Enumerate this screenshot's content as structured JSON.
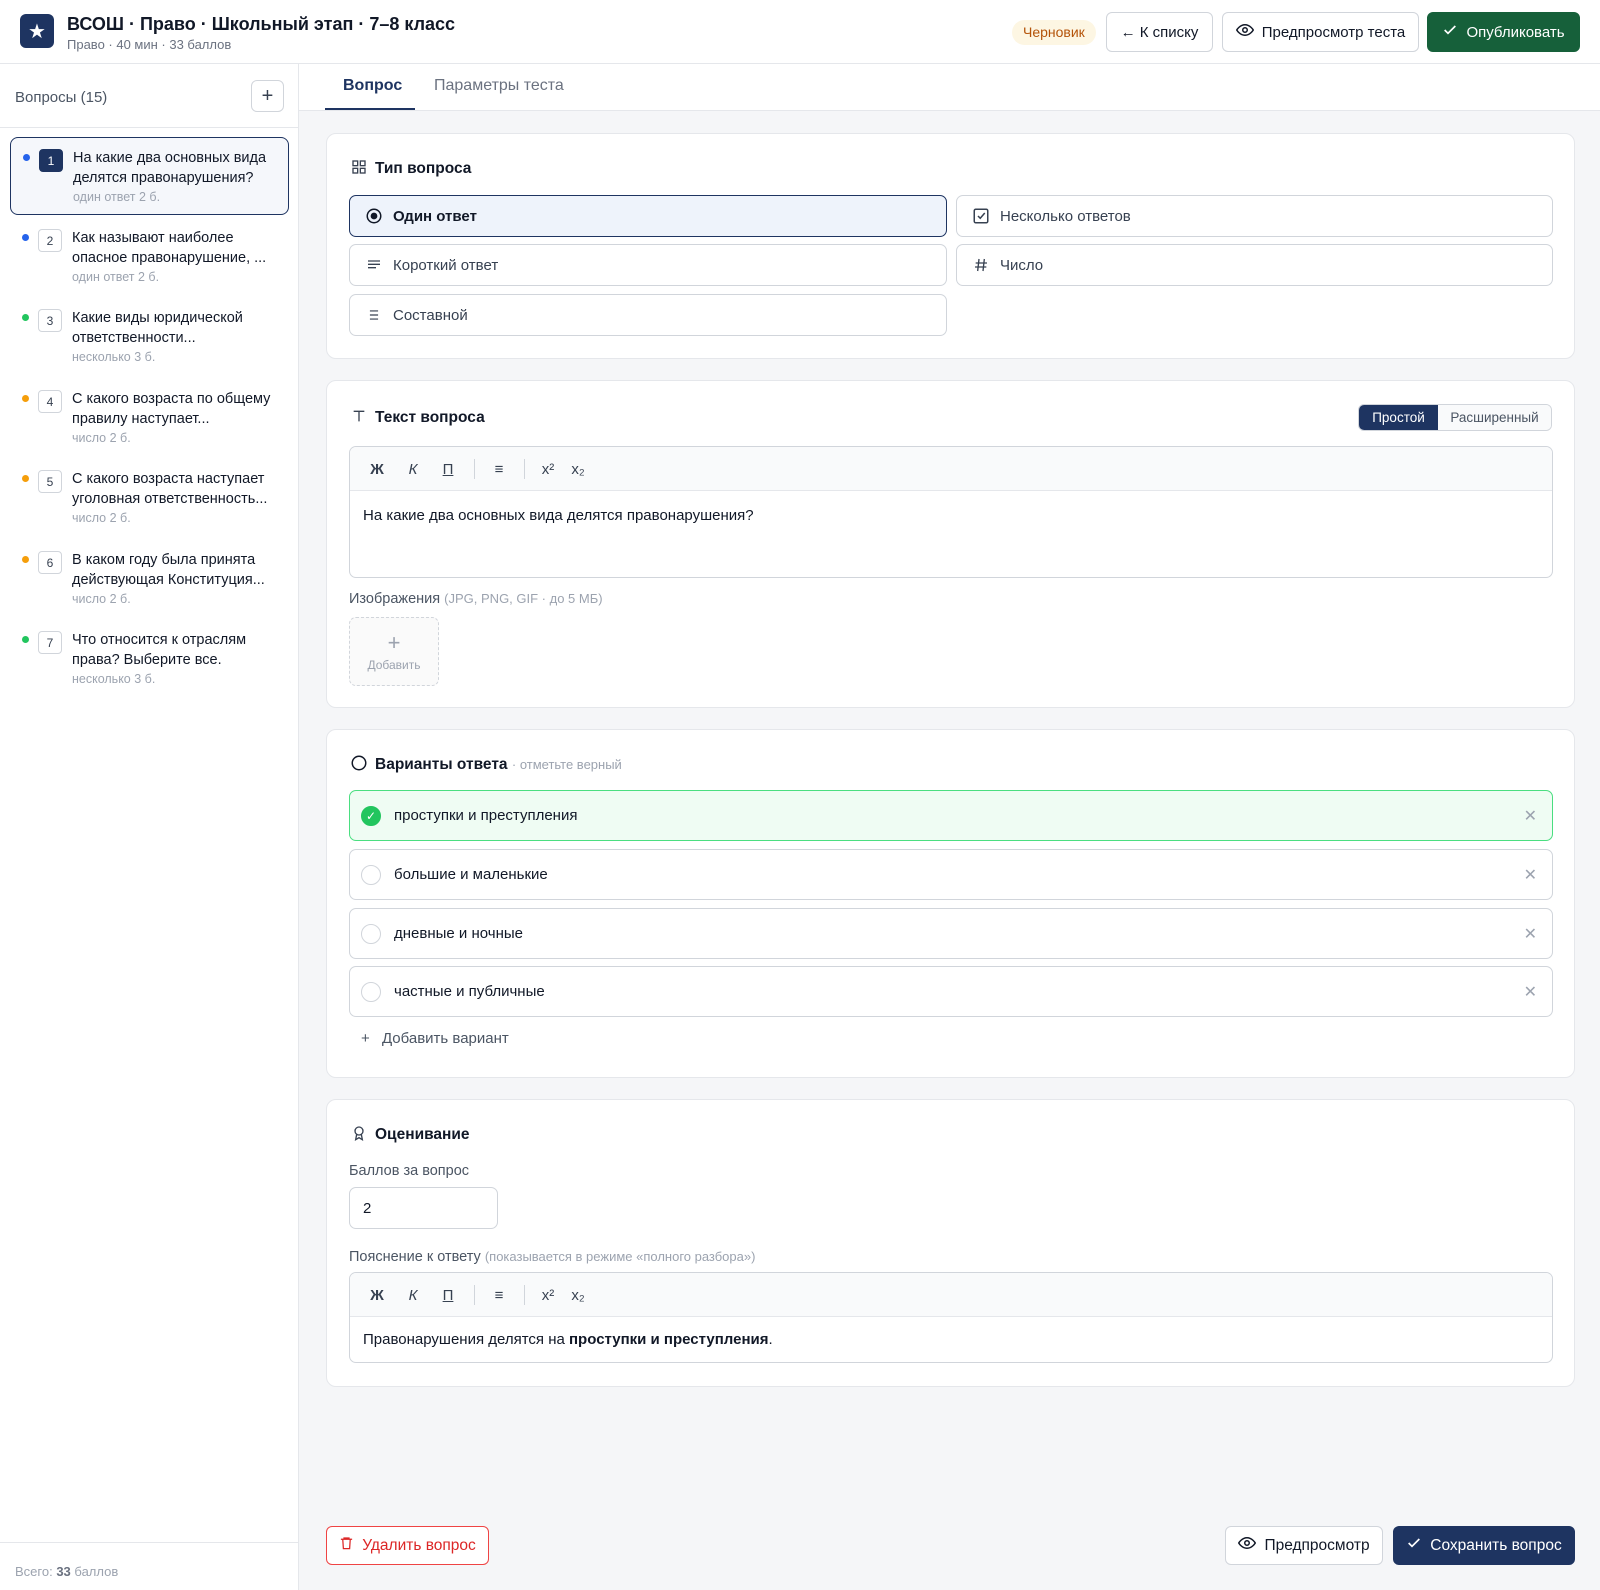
{
  "header": {
    "logo_glyph": "★",
    "title": "ВСОШ · Право · Школьный этап · 7–8 класс",
    "subtitle": "Право · 40 мин · 33 баллов",
    "status_badge": "Черновик",
    "back_label": "← К списку",
    "preview_test_label": "Предпросмотр теста",
    "publish_label": "Опубликовать"
  },
  "sidebar": {
    "heading": "Вопросы (15)",
    "add_label": "+",
    "items": [
      {
        "num": "1",
        "text": "На какие два основных вида делятся правонарушения?",
        "type": "один ответ",
        "points": "2 б.",
        "dot": "#2563eb",
        "active": true
      },
      {
        "num": "2",
        "text": "Как называют наиболее опасное правонарушение, ...",
        "type": "один ответ",
        "points": "2 б.",
        "dot": "#2563eb"
      },
      {
        "num": "3",
        "text": "Какие виды юридической ответственности...",
        "type": "несколько",
        "points": "3 б.",
        "dot": "#22c55e"
      },
      {
        "num": "4",
        "text": "С какого возраста по общему правилу наступает...",
        "type": "число",
        "points": "2 б.",
        "dot": "#f59e0b"
      },
      {
        "num": "5",
        "text": "С какого возраста наступает уголовная ответственность...",
        "type": "число",
        "points": "2 б.",
        "dot": "#f59e0b"
      },
      {
        "num": "6",
        "text": "В каком году была принята действующая Конституция...",
        "type": "число",
        "points": "2 б.",
        "dot": "#f59e0b"
      },
      {
        "num": "7",
        "text": "Что относится к отраслям права? Выберите все.",
        "type": "несколько",
        "points": "3 б.",
        "dot": "#22c55e"
      }
    ],
    "footer_prefix": "Всего:",
    "footer_total": "33",
    "footer_suffix": "баллов"
  },
  "tabs": {
    "question": "Вопрос",
    "params": "Параметры теста"
  },
  "question_type": {
    "title": "Тип вопроса",
    "options": {
      "single": "Один ответ",
      "multiple": "Несколько ответов",
      "short": "Короткий ответ",
      "number": "Число",
      "composite": "Составной"
    },
    "selected": "single"
  },
  "question_text": {
    "title": "Текст вопроса",
    "mode_simple": "Простой",
    "mode_advanced": "Расширенный",
    "toolbar": {
      "bold": "Ж",
      "italic": "К",
      "underline": "П",
      "list": "≡",
      "sup": "x²",
      "sub": "x₂"
    },
    "content": "На какие два основных вида делятся правонарушения?",
    "images_label": "Изображения",
    "images_hint": "(JPG, PNG, GIF · до 5 МБ)",
    "add_image_label": "Добавить"
  },
  "answers": {
    "title": "Варианты ответа",
    "hint": "· отметьте верный",
    "options": [
      {
        "text": "проступки и преступления",
        "correct": true
      },
      {
        "text": "большие и маленькие",
        "correct": false
      },
      {
        "text": "дневные и ночные",
        "correct": false
      },
      {
        "text": "частные и публичные",
        "correct": false
      }
    ],
    "add_label": "Добавить вариант"
  },
  "grading": {
    "title": "Оценивание",
    "points_label": "Баллов за вопрос",
    "points_value": "2",
    "explanation_label": "Пояснение к ответу",
    "explanation_hint": "(показывается в режиме «полного разбора»)",
    "explanation_prefix": "Правонарушения делятся на ",
    "explanation_bold": "проступки и преступления",
    "explanation_suffix": "."
  },
  "footer": {
    "delete_label": "Удалить вопрос",
    "preview_label": "Предпросмотр",
    "save_label": "Сохранить вопрос"
  },
  "colors": {
    "brand": "#1e3461",
    "publish": "#16603a",
    "correct": "#22c55e",
    "danger": "#dc2626"
  }
}
